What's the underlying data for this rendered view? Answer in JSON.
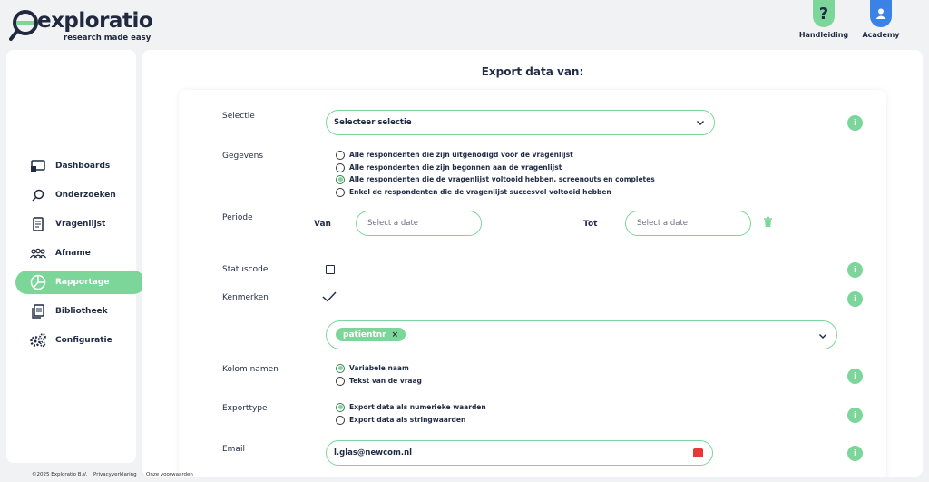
{
  "brand": {
    "name": "exploratio",
    "tagline": "research made easy",
    "accent": "#7cd69a"
  },
  "header": {
    "help": {
      "label": "Handleiding",
      "icon": "question-icon",
      "color": "#7cd69a"
    },
    "academy": {
      "label": "Academy",
      "icon": "user-icon",
      "color": "#3b82e6"
    }
  },
  "sidebar": {
    "items": [
      {
        "label": "Dashboards",
        "icon": "dashboard-icon"
      },
      {
        "label": "Onderzoeken",
        "icon": "search-icon"
      },
      {
        "label": "Vragenlijst",
        "icon": "document-icon"
      },
      {
        "label": "Afname",
        "icon": "people-icon"
      },
      {
        "label": "Rapportage",
        "icon": "pie-chart-icon",
        "active": true
      },
      {
        "label": "Bibliotheek",
        "icon": "library-icon"
      },
      {
        "label": "Configuratie",
        "icon": "gears-icon"
      }
    ]
  },
  "main": {
    "title": "Export data van:",
    "selectie": {
      "label": "Selectie",
      "value": "Selecteer selectie"
    },
    "gegevens": {
      "label": "Gegevens",
      "options": [
        "Alle respondenten die zijn uitgenodigd voor de vragenlijst",
        "Alle respondenten die zijn begonnen aan de vragenlijst",
        "Alle respondenten die de vragenlijst voltooid hebben, screenouts en completes",
        "Enkel de respondenten die de vragenlijst succesvol voltooid hebben"
      ],
      "selected_index": 2
    },
    "periode": {
      "label": "Periode",
      "from_label": "Van",
      "to_label": "Tot",
      "from_placeholder": "Select a date",
      "to_placeholder": "Select a date"
    },
    "statuscode": {
      "label": "Statuscode",
      "checked": false
    },
    "kenmerken": {
      "label": "Kenmerken",
      "chip": "patientnr",
      "chip_remove": "×"
    },
    "kolom_namen": {
      "label": "Kolom namen",
      "options": [
        "Variabele naam",
        "Tekst van de vraag"
      ],
      "selected_index": 0
    },
    "exporttype": {
      "label": "Exporttype",
      "options": [
        "Export data als numerieke waarden",
        "Export data als stringwaarden"
      ],
      "selected_index": 0
    },
    "email": {
      "label": "Email",
      "value": "l.glas@newcom.nl"
    },
    "info_glyph": "i"
  },
  "footer": {
    "copyright": "©2025 Exploratio B.V.",
    "privacy": "Privacyverklaring",
    "terms": "Onze voorwaarden"
  }
}
